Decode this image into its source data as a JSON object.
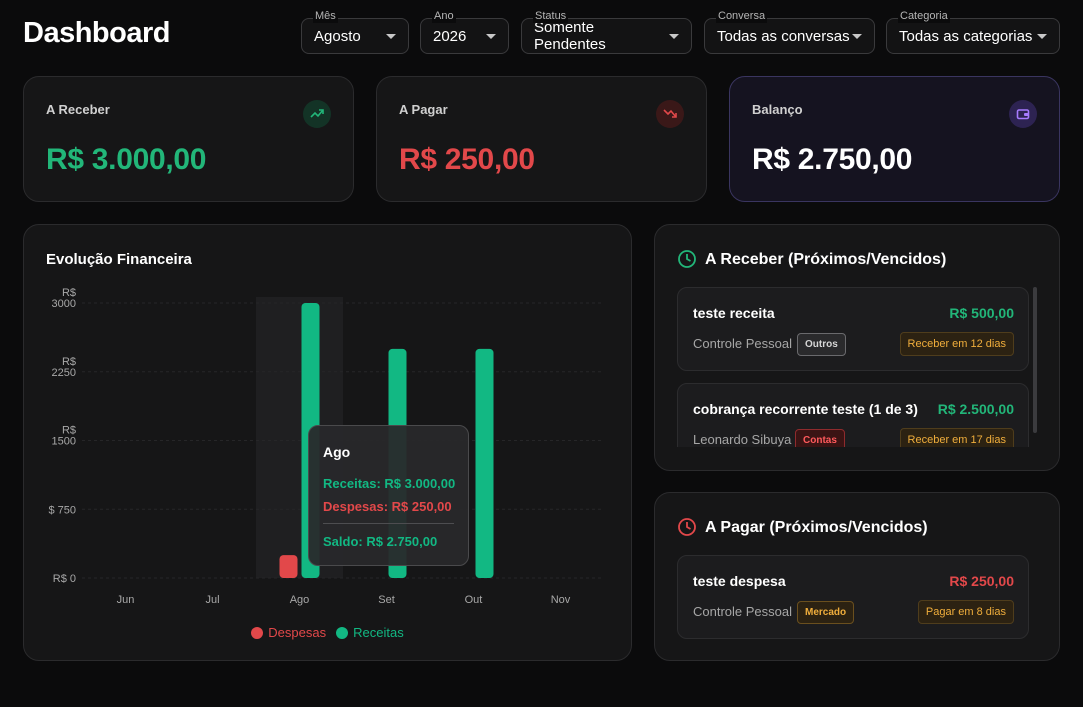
{
  "header": {
    "title": "Dashboard"
  },
  "filters": [
    {
      "label": "Mês",
      "value": "Agosto"
    },
    {
      "label": "Ano",
      "value": "2026"
    },
    {
      "label": "Status",
      "value": "Somente Pendentes"
    },
    {
      "label": "Conversa",
      "value": "Todas as conversas"
    },
    {
      "label": "Categoria",
      "value": "Todas as categorias"
    }
  ],
  "kpis": [
    {
      "label": "A Receber",
      "value": "R$ 3.000,00",
      "color": "#22b679",
      "icon": "trending-up-icon"
    },
    {
      "label": "A Pagar",
      "value": "R$ 250,00",
      "color": "#e2484a",
      "icon": "trending-down-icon"
    },
    {
      "label": "Balanço",
      "value": "R$ 2.750,00",
      "color": "#ffffff",
      "icon": "wallet-icon"
    }
  ],
  "chart": {
    "title": "Evolução Financeira",
    "tooltip": {
      "title": "Ago",
      "receitas": "Receitas: R$ 3.000,00",
      "despesas": "Despesas: R$ 250,00",
      "saldo": "Saldo: R$ 2.750,00"
    }
  },
  "chart_data": {
    "type": "bar",
    "categories": [
      "Jun",
      "Jul",
      "Ago",
      "Set",
      "Out",
      "Nov"
    ],
    "series": [
      {
        "name": "Despesas",
        "color": "#e2484a",
        "values": [
          0,
          0,
          250,
          0,
          0,
          0
        ]
      },
      {
        "name": "Receitas",
        "color": "#12b883",
        "values": [
          0,
          0,
          3000,
          2500,
          2500,
          0
        ]
      }
    ],
    "ylim": [
      0,
      3000
    ],
    "y_ticks": [
      {
        "value": 0,
        "lines": [
          "R$ 0"
        ]
      },
      {
        "value": 750,
        "lines": [
          "$ 750"
        ]
      },
      {
        "value": 1500,
        "lines": [
          "R$",
          "1500"
        ]
      },
      {
        "value": 2250,
        "lines": [
          "R$",
          "2250"
        ]
      },
      {
        "value": 3000,
        "lines": [
          "R$",
          "3000"
        ]
      }
    ],
    "legend_position": "bottom-center",
    "grid": true
  },
  "receivables": {
    "title": "A Receber (Próximos/Vencidos)",
    "items": [
      {
        "title": "teste receita",
        "amount": "R$ 500,00",
        "owner": "Controle Pessoal",
        "tag": "Outros",
        "due": "Receber em 12 dias"
      },
      {
        "title": "cobrança recorrente teste (1 de 3)",
        "amount": "R$ 2.500,00",
        "owner": "Leonardo Sibuya",
        "tag": "Contas",
        "due": "Receber em 17 dias"
      }
    ]
  },
  "payables": {
    "title": "A Pagar (Próximos/Vencidos)",
    "items": [
      {
        "title": "teste despesa",
        "amount": "R$ 250,00",
        "owner": "Controle Pessoal",
        "tag": "Mercado",
        "due": "Pagar em 8 dias"
      }
    ]
  }
}
